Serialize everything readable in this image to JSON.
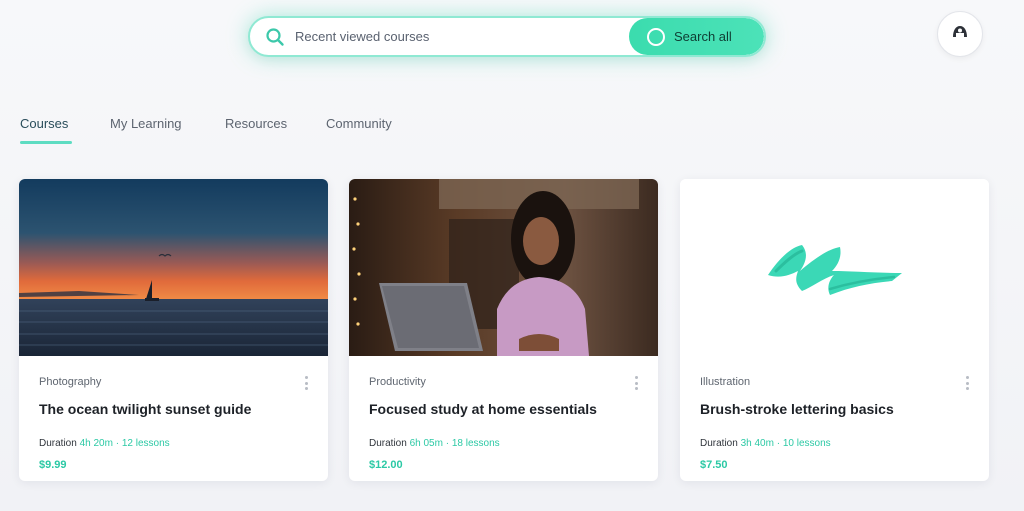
{
  "search": {
    "placeholder": "Recent viewed courses",
    "action_label": "Search all"
  },
  "tabs": [
    {
      "label": "Courses",
      "active": true
    },
    {
      "label": "My Learning",
      "active": false
    },
    {
      "label": "Resources",
      "active": false
    },
    {
      "label": "Community",
      "active": false
    }
  ],
  "cards": [
    {
      "category": "Photography",
      "title": "The ocean twilight sunset guide",
      "meta_label": "Duration",
      "meta_value": "4h 20m · 12 lessons",
      "price": "$9.99",
      "media_icon": "sunset-sea-image"
    },
    {
      "category": "Productivity",
      "title": "Focused study at home essentials",
      "meta_label": "Duration",
      "meta_value": "6h 05m · 18 lessons",
      "price": "$12.00",
      "media_icon": "student-laptop-image"
    },
    {
      "category": "Illustration",
      "title": "Brush-stroke lettering basics",
      "meta_label": "Duration",
      "meta_value": "3h 40m · 10 lessons",
      "price": "$7.50",
      "media_icon": "brush-stroke-image"
    }
  ],
  "colors": {
    "accent": "#3bdcae",
    "accent_text": "#2cc9a5",
    "tab_underline": "#5ddcc2"
  }
}
